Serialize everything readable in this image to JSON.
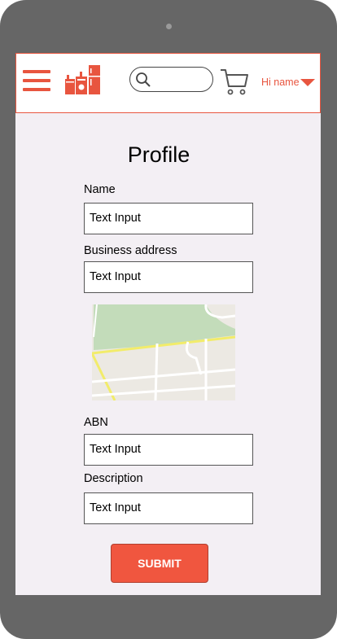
{
  "header": {
    "greeting": "Hi name",
    "search": {
      "placeholder": ""
    }
  },
  "page": {
    "title": "Profile"
  },
  "form": {
    "name": {
      "label": "Name",
      "value": "Text Input"
    },
    "business_address": {
      "label": "Business address",
      "value": "Text Input"
    },
    "abn": {
      "label": "ABN",
      "value": "Text Input"
    },
    "description": {
      "label": "Description",
      "value": "Text Input"
    },
    "submit_label": "SUBMIT"
  },
  "icons": {
    "menu": "hamburger-icon",
    "logo": "appliances-logo",
    "search": "search-icon",
    "cart": "cart-icon",
    "dropdown": "caret-down-icon"
  },
  "colors": {
    "accent": "#e8553f",
    "device": "#666666",
    "screen_bg": "#f3eff4",
    "button": "#f0563f"
  }
}
